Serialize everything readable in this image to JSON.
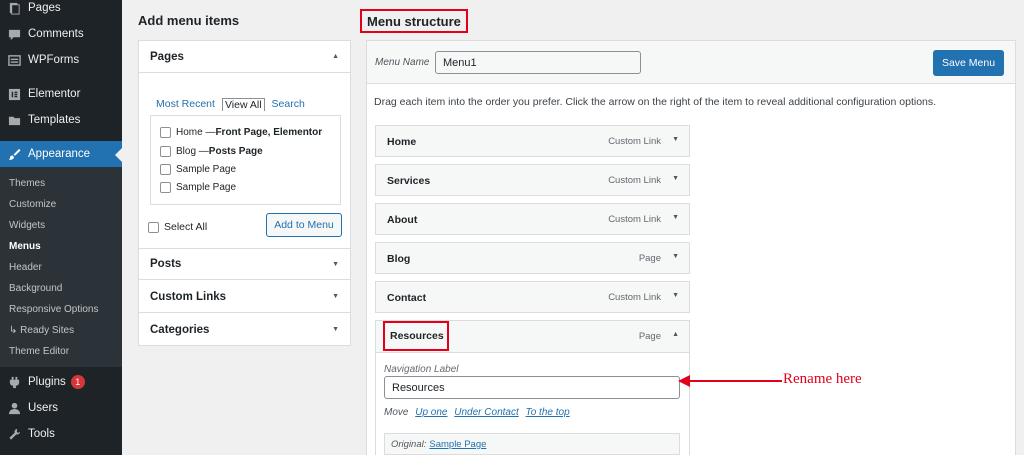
{
  "sidebar": {
    "items": [
      {
        "label": "Pages",
        "icon": "pages-icon"
      },
      {
        "label": "Comments",
        "icon": "comments-icon"
      },
      {
        "label": "WPForms",
        "icon": "wpforms-icon"
      },
      {
        "label": "Elementor",
        "icon": "elementor-icon"
      },
      {
        "label": "Templates",
        "icon": "templates-icon"
      },
      {
        "label": "Appearance",
        "icon": "appearance-icon"
      },
      {
        "label": "Plugins",
        "icon": "plugins-icon",
        "badge": "1"
      },
      {
        "label": "Users",
        "icon": "users-icon"
      },
      {
        "label": "Tools",
        "icon": "tools-icon"
      }
    ],
    "submenu": [
      "Themes",
      "Customize",
      "Widgets",
      "Menus",
      "Header",
      "Background",
      "Responsive Options",
      "↳ Ready Sites",
      "Theme Editor"
    ]
  },
  "add_menu_items": {
    "title": "Add menu items",
    "sections": [
      "Pages",
      "Posts",
      "Custom Links",
      "Categories"
    ],
    "tabs": [
      "Most Recent",
      "View All",
      "Search"
    ],
    "pages": [
      {
        "label": "Home — ",
        "bold": "Front Page, Elementor"
      },
      {
        "label": "Blog — ",
        "bold": "Posts Page"
      },
      {
        "label": "Sample Page",
        "bold": ""
      },
      {
        "label": "Sample Page",
        "bold": ""
      }
    ],
    "select_all": "Select All",
    "add_button": "Add to Menu"
  },
  "menu_structure": {
    "title": "Menu structure",
    "menu_name_label": "Menu Name",
    "menu_name_value": "Menu1",
    "save_button": "Save Menu",
    "instructions": "Drag each item into the order you prefer. Click the arrow on the right of the item to reveal additional configuration options.",
    "items": [
      {
        "title": "Home",
        "type": "Custom Link"
      },
      {
        "title": "Services",
        "type": "Custom Link"
      },
      {
        "title": "About",
        "type": "Custom Link"
      },
      {
        "title": "Blog",
        "type": "Page"
      },
      {
        "title": "Contact",
        "type": "Custom Link"
      }
    ],
    "expanded_item": {
      "title": "Resources",
      "type": "Page",
      "nav_label_caption": "Navigation Label",
      "nav_label_value": "Resources",
      "move_label": "Move",
      "move_links": [
        "Up one",
        "Under Contact",
        "To the top"
      ],
      "original_label": "Original:",
      "original_link": "Sample Page"
    }
  },
  "annotation": {
    "text": "Rename here",
    "color": "#e3001b"
  },
  "colors": {
    "accent": "#2271b1",
    "sidebar": "#1d2327",
    "highlight": "#e3001b"
  }
}
